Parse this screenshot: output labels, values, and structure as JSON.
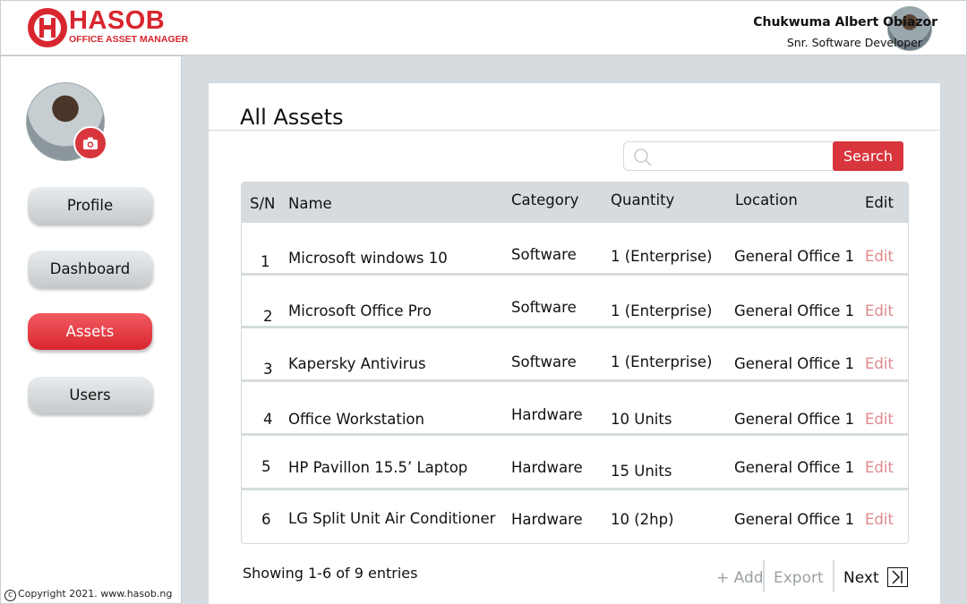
{
  "brand": {
    "name": "HASOB",
    "tagline": "OFFICE ASSET MANAGER",
    "color": "#d8262f"
  },
  "user": {
    "name": "Chukwuma Albert Obiazor",
    "role": "Snr. Software Developer"
  },
  "sidebar": {
    "items": [
      {
        "label": "Profile",
        "active": false
      },
      {
        "label": "Dashboard",
        "active": false
      },
      {
        "label": "Assets",
        "active": true
      },
      {
        "label": "Users",
        "active": false
      }
    ],
    "copyright": "Copyright 2021. www.hasob.ng"
  },
  "main": {
    "title": "All Assets",
    "search": {
      "placeholder": "",
      "button_label": "Search"
    },
    "table": {
      "headers": [
        "S/N",
        "Name",
        "Category",
        "Quantity",
        "Location",
        "Edit"
      ],
      "rows": [
        {
          "sn": "1",
          "name": "Microsoft windows 10",
          "category": "Software",
          "quantity": "1 (Enterprise)",
          "location": "General Office 1",
          "edit": "Edit"
        },
        {
          "sn": "2",
          "name": "Microsoft Office Pro",
          "category": "Software",
          "quantity": "1 (Enterprise)",
          "location": "General Office 1",
          "edit": "Edit"
        },
        {
          "sn": "3",
          "name": "Kapersky Antivirus",
          "category": "Software",
          "quantity": "1 (Enterprise)",
          "location": "General Office 1",
          "edit": "Edit"
        },
        {
          "sn": "4",
          "name": "Office Workstation",
          "category": "Hardware",
          "quantity": "10 Units",
          "location": "General Office 1",
          "edit": "Edit"
        },
        {
          "sn": "5",
          "name": "HP Pavillon 15.5’ Laptop",
          "category": "Hardware",
          "quantity": "15 Units",
          "location": "General Office 1",
          "edit": "Edit"
        },
        {
          "sn": "6",
          "name": "LG Split Unit Air Conditioner",
          "category": "Hardware",
          "quantity": "10 (2hp)",
          "location": "General Office 1",
          "edit": "Edit"
        }
      ]
    },
    "footer": {
      "showing": "Showing 1-6 of 9 entries",
      "add_label": "+ Add",
      "export_label": "Export",
      "next_label": "Next"
    }
  }
}
